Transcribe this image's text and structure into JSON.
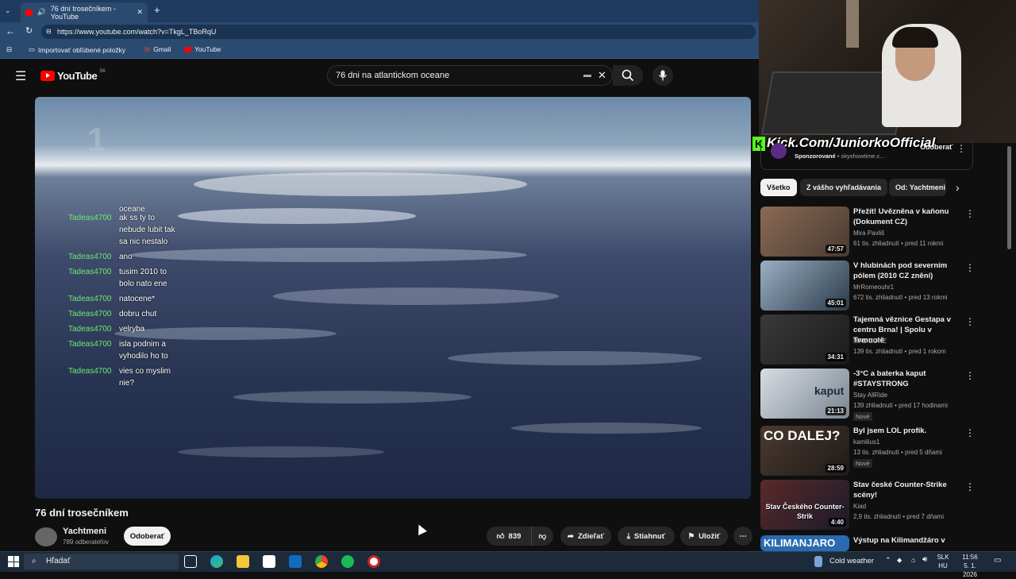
{
  "browser": {
    "tab_title": "76 dní trosečníkem - YouTube",
    "url": "https://www.youtube.com/watch?v=TkgL_TBoRqU",
    "bookmarks": [
      "Importovať obľúbené položky",
      "Gmail",
      "YouTube"
    ]
  },
  "youtube": {
    "brand": "YouTube",
    "country": "SK",
    "search_query": "76 dni na atlantickom oceane"
  },
  "video": {
    "watermark": "1",
    "title": "76 dní trosečníkem",
    "channel": "Yachtmeni",
    "subscribers": "789 odberateľov",
    "subscribe_label": "Odoberať",
    "likes": "839",
    "share_label": "Zdieľať",
    "download_label": "Stiahnuť",
    "save_label": "Uložiť"
  },
  "chat": {
    "top_line": "oceane",
    "messages": [
      {
        "user": "Tadeas4700",
        "text": "ak ss ty to nebude lubit tak sa nic nestalo"
      },
      {
        "user": "Tadeas4700",
        "text": "ano"
      },
      {
        "user": "Tadeas4700",
        "text": "tusim 2010 to bolo nato ene"
      },
      {
        "user": "Tadeas4700",
        "text": "natocene*"
      },
      {
        "user": "Tadeas4700",
        "text": "dobru chut"
      },
      {
        "user": "Tadeas4700",
        "text": "velryba"
      },
      {
        "user": "Tadeas4700",
        "text": "isla podnim a vyhodilo ho to"
      },
      {
        "user": "Tadeas4700",
        "text": "vies co myslim nie?"
      }
    ]
  },
  "overlay": {
    "kick_text": "Kick.Com/JuniorkoOfficial",
    "ad_label": "Sponzorované",
    "ad_domain": "skyshowtime.c...",
    "ad_button": "Odoberať"
  },
  "filter_chips": [
    "Všetko",
    "Z vášho vyhľadávania",
    "Od: Yachtmeni"
  ],
  "recommendations": [
    {
      "title": "Přežít! Uvězněna v kaňonu (Dokument CZ)",
      "channel": "Mira Pavliš",
      "meta": "61 tis. zhliadnutí • pred 11 rokmi",
      "duration": "47:57",
      "new": ""
    },
    {
      "title": "V hlubinách pod severním pólem (2010 CZ znění)",
      "channel": "MrRomeouhr1",
      "meta": "672 tis. zhliadnutí • pred 13 rokmi",
      "duration": "45:01",
      "new": ""
    },
    {
      "title": "Tajemná věznice Gestapa v centru Brna! | Spolu v Temnotě",
      "channel": "MAD ZONE",
      "meta": "139 tis. zhliadnutí • pred 1 rokom",
      "duration": "34:31",
      "new": ""
    },
    {
      "title": "-3°C a baterka kaput #STAYSTRONG",
      "channel": "Stay AllRide",
      "meta": "139 zhliadnutí • pred 17 hodinami",
      "duration": "21:13",
      "new": "Nové"
    },
    {
      "title": "Byl jsem LOL profík.",
      "channel": "kamilius1",
      "meta": "13 tis. zhliadnutí • pred 5 dňami",
      "duration": "28:59",
      "new": "Nové"
    },
    {
      "title": "Stav české Counter-Strike scény!",
      "channel": "Kiad",
      "meta": "2,9 tis. zhliadnutí • pred 7 dňami",
      "duration": "4:40",
      "new": ""
    },
    {
      "title": "Výstup na Kilimandžáro v",
      "channel": "",
      "meta": "",
      "duration": "",
      "new": ""
    }
  ],
  "thumb_text": [
    "",
    "",
    "",
    "kaput",
    "CO DALEJ?",
    "Stav Českého Counter-Strik",
    "KILIMANJARO"
  ],
  "taskbar": {
    "search_placeholder": "Hľadať",
    "weather": "Cold weather",
    "lang_1": "SLK",
    "lang_2": "HU",
    "time": "11:56",
    "date": "5. 1. 2026"
  },
  "colors": {
    "chat_user": "#6ee86e",
    "kick_green": "#53fc18",
    "yt_red": "#ff0000"
  }
}
